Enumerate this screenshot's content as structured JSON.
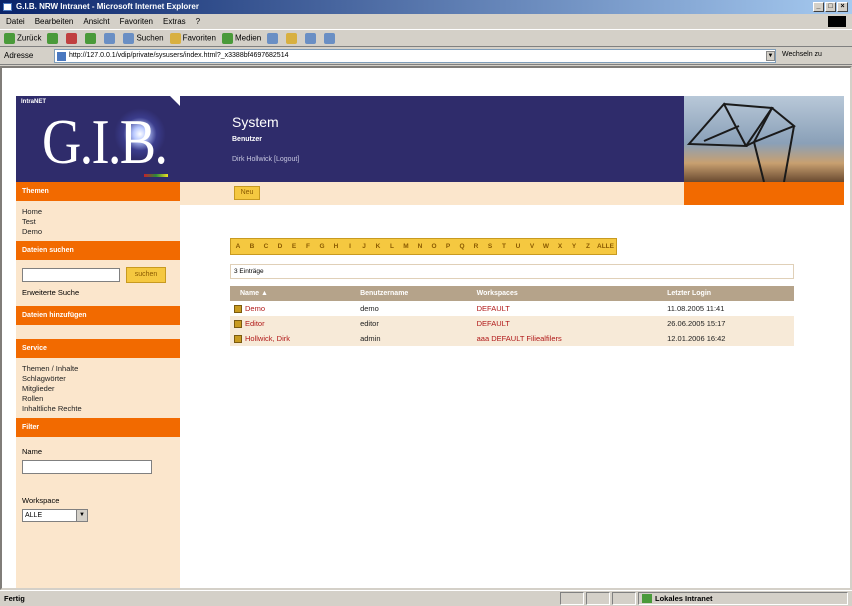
{
  "window": {
    "title": "G.I.B. NRW Intranet - Microsoft Internet Explorer"
  },
  "menu": [
    "Datei",
    "Bearbeiten",
    "Ansicht",
    "Favoriten",
    "Extras",
    "?"
  ],
  "toolbar": {
    "back": "Zurück",
    "search": "Suchen",
    "favorites": "Favoriten",
    "media": "Medien"
  },
  "address": {
    "label": "Adresse",
    "url": "http://127.0.0.1/vdip/private/sysusers/index.html?_x3388bf4697682514",
    "go": "Wechseln zu"
  },
  "logo": {
    "tag": "IntraNET",
    "text": "G.I.B."
  },
  "header": {
    "title": "System",
    "subtitle": "Benutzer",
    "user": "Dirk Hollwick [Logout]"
  },
  "subbar": {
    "new_label": "Neu"
  },
  "sidebar": {
    "themen": {
      "title": "Themen",
      "items": [
        "Home",
        "Test",
        "Demo"
      ]
    },
    "suchen": {
      "title": "Dateien suchen",
      "button": "suchen",
      "extended": "Erweiterte Suche"
    },
    "hinzufuegen": {
      "title": "Dateien hinzufügen"
    },
    "service": {
      "title": "Service",
      "items": [
        "Themen / Inhalte",
        "Schlagwörter",
        "Mitglieder",
        "Rollen",
        "Inhaltliche Rechte"
      ]
    },
    "filter": {
      "title": "Filter",
      "name_label": "Name",
      "workspace_label": "Workspace",
      "workspace_value": "ALLE"
    }
  },
  "alphabet": [
    "A",
    "B",
    "C",
    "D",
    "E",
    "F",
    "G",
    "H",
    "I",
    "J",
    "K",
    "L",
    "M",
    "N",
    "O",
    "P",
    "Q",
    "R",
    "S",
    "T",
    "U",
    "V",
    "W",
    "X",
    "Y",
    "Z",
    "ALLE"
  ],
  "count": "3 Einträge",
  "table": {
    "columns": [
      "Name",
      "Benutzername",
      "Workspaces",
      "Letzter Login"
    ],
    "rows": [
      {
        "name": "Demo",
        "user": "demo",
        "workspaces": "DEFAULT",
        "login": "11.08.2005 11:41"
      },
      {
        "name": "Editor",
        "user": "editor",
        "workspaces": "DEFAULT",
        "login": "26.06.2005 15:17"
      },
      {
        "name": "Hollwick, Dirk",
        "user": "admin",
        "workspaces": "aaa DEFAULT Filiealfilers",
        "login": "12.01.2006 16:42"
      }
    ]
  },
  "status": {
    "text": "Fertig",
    "zone": "Lokales Intranet"
  },
  "colors": {
    "accent": "#f26a00",
    "header": "#2f2c6b",
    "sidebar": "#fbe6cc",
    "button": "#f5c840"
  }
}
